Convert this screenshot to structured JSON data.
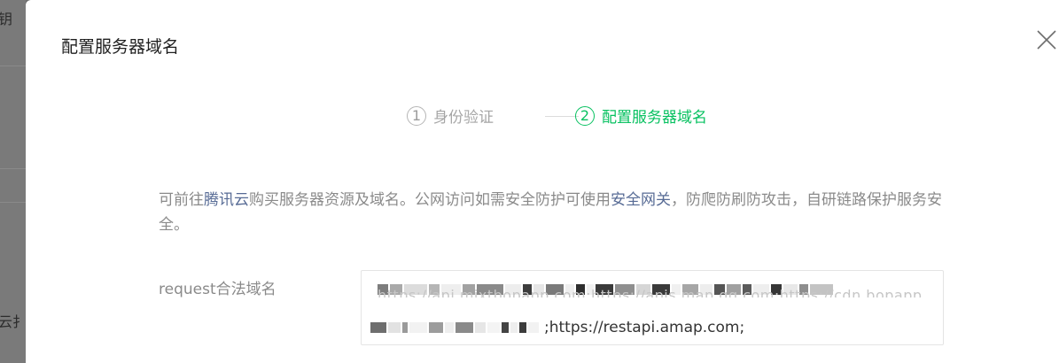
{
  "background": {
    "text_top": "钥",
    "text_bottom": "云扌"
  },
  "dialog": {
    "title": "配置服务器域名",
    "close_icon": "close-icon"
  },
  "steps": [
    {
      "number": "1",
      "label": "身份验证",
      "state": "done"
    },
    {
      "number": "2",
      "label": "配置服务器域名",
      "state": "active"
    }
  ],
  "description": {
    "part1": "可前往",
    "link1": "腾讯云",
    "part2": "购买服务器资源及域名。公网访问如需安全防护可使用",
    "link2": "安全网关",
    "part3": "，防爬防刷防攻击，自研链路保护服务安全。"
  },
  "form": {
    "request_label": "request合法域名",
    "request_value_line2": ";https://restapi.amap.com;"
  },
  "colors": {
    "accent_green": "#07c160",
    "link_blue": "#576b95",
    "muted_text": "#8a8a8a"
  }
}
